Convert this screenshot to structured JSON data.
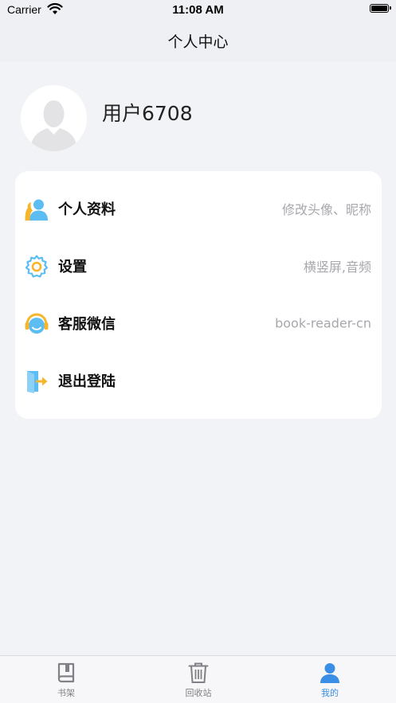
{
  "status_bar": {
    "carrier": "Carrier",
    "time": "11:08 AM"
  },
  "nav": {
    "title": "个人中心"
  },
  "profile": {
    "username": "用户6708",
    "avatar_icon": "default-user-avatar-icon"
  },
  "menu": {
    "items": [
      {
        "label": "个人资料",
        "detail": "修改头像、昵称",
        "icon": "profile-icon"
      },
      {
        "label": "设置",
        "detail": "横竖屏,音频",
        "icon": "settings-gear-icon"
      },
      {
        "label": "客服微信",
        "detail": "book-reader-cn",
        "icon": "customer-service-icon"
      },
      {
        "label": "退出登陆",
        "detail": "",
        "icon": "logout-door-icon"
      }
    ]
  },
  "tabbar": {
    "tabs": [
      {
        "label": "书架",
        "icon": "bookshelf-icon",
        "active": false
      },
      {
        "label": "回收站",
        "icon": "trash-icon",
        "active": false
      },
      {
        "label": "我的",
        "icon": "user-icon",
        "active": true
      }
    ]
  },
  "colors": {
    "accent": "#3b8ee5",
    "background": "#f2f3f6",
    "icon_blue": "#5bbdf2",
    "icon_orange": "#f7b52c"
  }
}
